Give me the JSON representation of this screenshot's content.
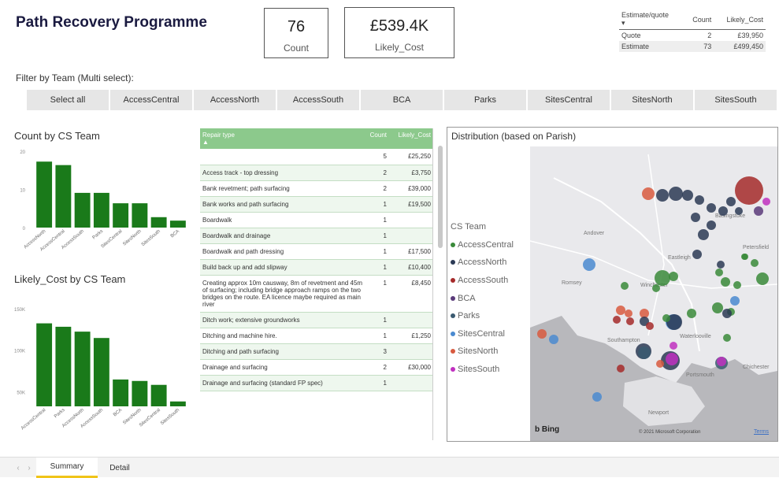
{
  "report": {
    "title": "Path Recovery Programme"
  },
  "cards": [
    {
      "value": "76",
      "label": "Count"
    },
    {
      "value": "£539.4K",
      "label": "Likely_Cost"
    }
  ],
  "quote_table": {
    "headers": [
      "Estimate/quote",
      "Count",
      "Likely_Cost"
    ],
    "rows": [
      {
        "type": "Quote",
        "count": "2",
        "cost": "£39,950"
      },
      {
        "type": "Estimate",
        "count": "73",
        "cost": "£499,450"
      }
    ]
  },
  "filter": {
    "label": "Filter by Team (Multi select):",
    "options": [
      "Select all",
      "AccessCentral",
      "AccessNorth",
      "AccessSouth",
      "BCA",
      "Parks",
      "SitesCentral",
      "SitesNorth",
      "SitesSouth"
    ]
  },
  "colors": {
    "bar": "#1a7a1a",
    "header_green": "#8cc98c",
    "tab_accent": "#f0c419"
  },
  "chart_data": [
    {
      "type": "bar",
      "title": "Count by CS Team",
      "categories": [
        "AccessNorth",
        "AccessCentral",
        "AccessSouth",
        "Parks",
        "SitesCentral",
        "SitesNorth",
        "SitesSouth",
        "BCA"
      ],
      "values": [
        19,
        18,
        10,
        10,
        7,
        7,
        3,
        2
      ],
      "ylim": [
        0,
        22
      ],
      "yticks": [
        "20",
        "10",
        "0"
      ]
    },
    {
      "type": "bar",
      "title": "Likely_Cost by CS Team",
      "categories": [
        "AccessCentral",
        "Parks",
        "AccessNorth",
        "AccessSouth",
        "BCA",
        "SitesNorth",
        "SitesCentral",
        "SitesSouth"
      ],
      "values": [
        170000,
        163000,
        153000,
        140000,
        55000,
        52000,
        44000,
        10000
      ],
      "ylim": [
        0,
        200000
      ],
      "yticks": [
        "150K",
        "100K",
        "50K"
      ]
    }
  ],
  "repair_table": {
    "headers": [
      "Repair type",
      "Count",
      "Likely_Cost"
    ],
    "rows": [
      {
        "type": "",
        "count": "5",
        "cost": "£25,250"
      },
      {
        "type": "Access track - top dressing",
        "count": "2",
        "cost": "£3,750"
      },
      {
        "type": "Bank revetment; path surfacing",
        "count": "2",
        "cost": "£39,000"
      },
      {
        "type": "Bank works and path surfacing",
        "count": "1",
        "cost": "£19,500"
      },
      {
        "type": "Boardwalk",
        "count": "1",
        "cost": ""
      },
      {
        "type": "Boardwalk and drainage",
        "count": "1",
        "cost": ""
      },
      {
        "type": "Boardwalk and path dressing",
        "count": "1",
        "cost": "£17,500"
      },
      {
        "type": "Build back up and add slipway",
        "count": "1",
        "cost": "£10,400"
      },
      {
        "type": "Creating approx 10m causway, 8m of revetment and 45m of surfacing; including bridge approach ramps on the two bridges on the route. EA licence maybe required as main river",
        "count": "1",
        "cost": "£8,450"
      },
      {
        "type": "Ditch work; extensive groundworks",
        "count": "1",
        "cost": ""
      },
      {
        "type": "Ditching and machine hire.",
        "count": "1",
        "cost": "£1,250"
      },
      {
        "type": "Ditching and path surfacing",
        "count": "3",
        "cost": ""
      },
      {
        "type": "Drainage and surfacing",
        "count": "2",
        "cost": "£30,000"
      },
      {
        "type": "Drainage and surfacing (standard FP spec)",
        "count": "1",
        "cost": ""
      }
    ]
  },
  "map": {
    "title": "Distribution (based on Parish)",
    "legend_title": "CS Team",
    "legend": [
      {
        "name": "AccessCentral",
        "color": "#3a8a3a"
      },
      {
        "name": "AccessNorth",
        "color": "#2b3a55"
      },
      {
        "name": "AccessSouth",
        "color": "#a52a2a"
      },
      {
        "name": "BCA",
        "color": "#5a3a7a"
      },
      {
        "name": "Parks",
        "color": "#3a5a70"
      },
      {
        "name": "SitesCentral",
        "color": "#4a8ad0"
      },
      {
        "name": "SitesNorth",
        "color": "#d85a40"
      },
      {
        "name": "SitesSouth",
        "color": "#c030c0"
      }
    ],
    "place_labels": [
      "Winchester",
      "Eastleigh",
      "Andover",
      "Romsey",
      "Southampton",
      "Waterlooville",
      "Portsmouth",
      "Newport",
      "Chichester",
      "Petersfield",
      "Basingstoke"
    ],
    "attribution": "© 2021 Microsoft Corporation",
    "terms": "Terms",
    "bing": "Bing"
  },
  "tabs": [
    "Summary",
    "Detail"
  ]
}
